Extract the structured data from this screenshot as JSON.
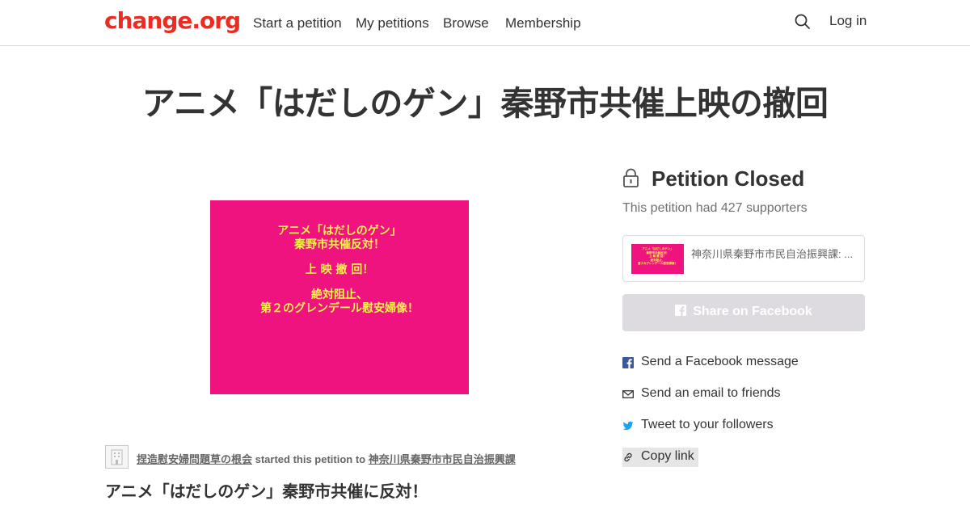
{
  "header": {
    "logo": "change.org",
    "nav": [
      "Start a petition",
      "My petitions",
      "Browse",
      "Membership"
    ],
    "login": "Log in"
  },
  "petition": {
    "title": "アニメ「はだしのゲン」秦野市共催上映の撤回",
    "image_lines": [
      "アニメ「はだしのゲン」",
      "秦野市共催反対！",
      "",
      "上 映 撤 回！",
      "",
      "絶対阻止、",
      "第２のグレンデール慰安婦像！"
    ],
    "starter_name": "捏造慰安婦問題草の根会",
    "starter_mid": " started this petition to ",
    "starter_target": "神奈川県秦野市市民自治振興課",
    "subheading": "アニメ「はだしのゲン」秦野市共催に反対！"
  },
  "sidebar": {
    "closed_title": "Petition Closed",
    "supporters_text": "This petition had 427 supporters",
    "target_card_name": "神奈川県秦野市市民自治振興課: ...",
    "fb_button": "Share on Facebook",
    "share_items": [
      {
        "label": "Send a Facebook message",
        "icon": "facebook-icon"
      },
      {
        "label": "Send an email to friends",
        "icon": "envelope-icon"
      },
      {
        "label": "Tweet to your followers",
        "icon": "twitter-icon"
      },
      {
        "label": "Copy link",
        "icon": "link-icon"
      }
    ]
  },
  "colors": {
    "brand": "#ec2c22",
    "image_bg": "#ee137f",
    "image_text": "#fff24c",
    "facebook": "#3b5998",
    "twitter": "#1da1f2",
    "disabled_button": "#dddbdf"
  }
}
